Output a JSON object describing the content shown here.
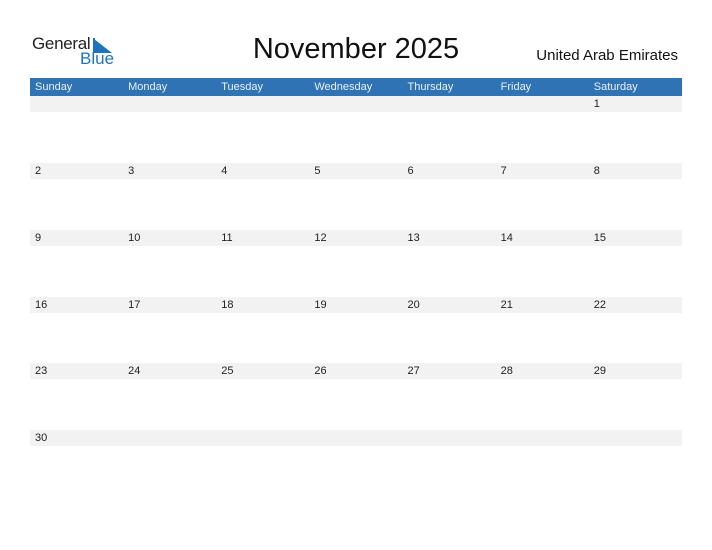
{
  "logo": {
    "general": "General",
    "blue": "Blue"
  },
  "title": "November 2025",
  "country": "United Arab Emirates",
  "colors": {
    "accent": "#2f73b4",
    "day_bg": "#f2f2f2"
  },
  "weekdays": [
    "Sunday",
    "Monday",
    "Tuesday",
    "Wednesday",
    "Thursday",
    "Friday",
    "Saturday"
  ],
  "weeks": [
    [
      "",
      "",
      "",
      "",
      "",
      "",
      "1"
    ],
    [
      "2",
      "3",
      "4",
      "5",
      "6",
      "7",
      "8"
    ],
    [
      "9",
      "10",
      "11",
      "12",
      "13",
      "14",
      "15"
    ],
    [
      "16",
      "17",
      "18",
      "19",
      "20",
      "21",
      "22"
    ],
    [
      "23",
      "24",
      "25",
      "26",
      "27",
      "28",
      "29"
    ],
    [
      "30",
      "",
      "",
      "",
      "",
      "",
      ""
    ]
  ]
}
